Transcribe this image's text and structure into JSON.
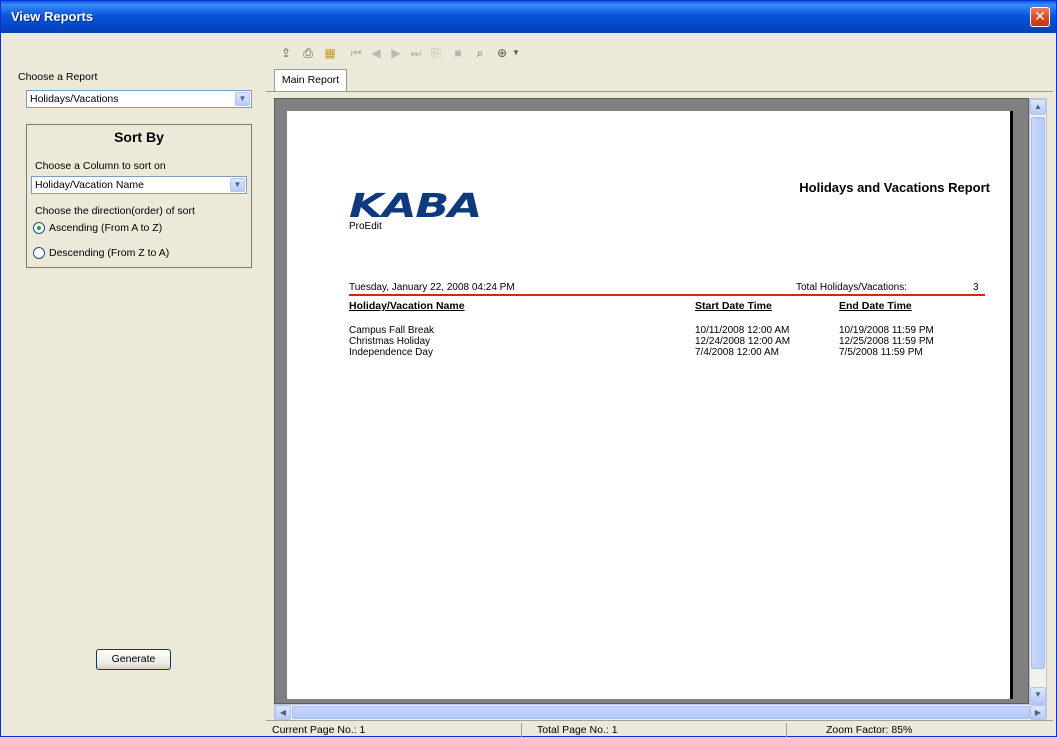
{
  "window": {
    "title": "View Reports"
  },
  "left_panel": {
    "report_label": "Choose a Report",
    "report_selected": "Holidays/Vacations",
    "sort": {
      "title": "Sort By",
      "column_label": "Choose a Column to sort on",
      "column_selected": "Holiday/Vacation Name",
      "direction_label": "Choose the direction(order) of sort",
      "options": [
        {
          "label": "Ascending (From A to Z)",
          "checked": true
        },
        {
          "label": "Descending (From Z to A)",
          "checked": false
        }
      ]
    },
    "generate_label": "Generate"
  },
  "toolbar": {
    "icons": [
      "export-icon",
      "print-icon",
      "tree-toggle-icon",
      "first-page-icon",
      "previous-page-icon",
      "next-page-icon",
      "last-page-icon",
      "goto-page-icon",
      "stop-icon",
      "search-icon",
      "zoom-icon"
    ]
  },
  "tabs": [
    {
      "label": "Main Report"
    }
  ],
  "report": {
    "logo_text": "KABA",
    "product": "ProEdit",
    "title": "Holidays and Vacations Report",
    "generated": "Tuesday, January 22, 2008 04:24 PM",
    "total_label": "Total Holidays/Vacations:",
    "total_value": "3",
    "columns": [
      "Holiday/Vacation Name",
      "Start Date Time",
      "End Date Time"
    ],
    "rows": [
      [
        "Campus Fall Break",
        "10/11/2008 12:00 AM",
        "10/19/2008 11:59 PM"
      ],
      [
        "Christmas Holiday",
        "12/24/2008 12:00 AM",
        "12/25/2008 11:59 PM"
      ],
      [
        "Independence Day",
        "7/4/2008 12:00 AM",
        "7/5/2008 11:59 PM"
      ]
    ]
  },
  "status": {
    "current_page": "Current Page No.: 1",
    "total_page": "Total Page No.: 1",
    "zoom": "Zoom Factor: 85%"
  },
  "colors": {
    "title_bar": "#0A5FE6",
    "logo": "#0C3A7D",
    "rule": "#E0201A"
  }
}
